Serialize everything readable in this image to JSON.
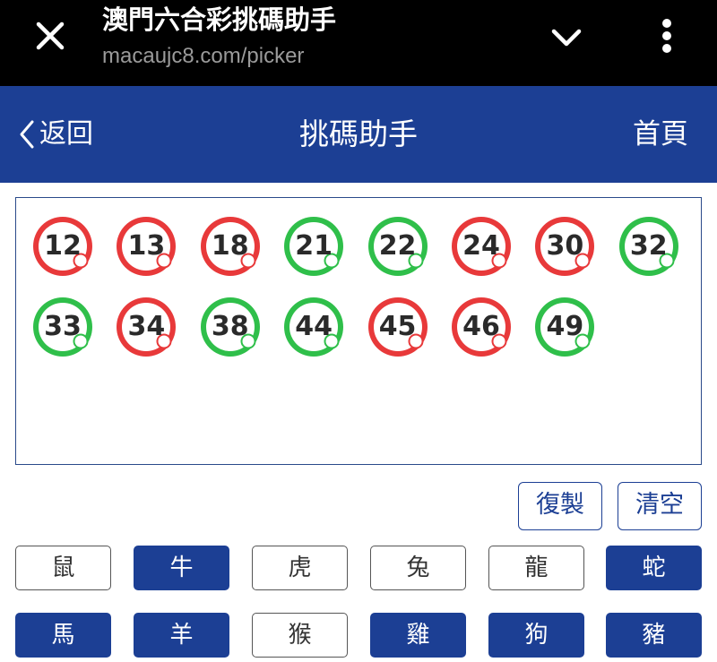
{
  "browser": {
    "title": "澳門六合彩挑碼助手",
    "url": "macaujc8.com/picker"
  },
  "header": {
    "back_label": "返回",
    "title": "挑碼助手",
    "home_label": "首頁",
    "color": "#1c3f94"
  },
  "colors": {
    "red": "#e8393a",
    "green": "#2fbf4a"
  },
  "numbers": [
    {
      "value": "12",
      "color": "red"
    },
    {
      "value": "13",
      "color": "red"
    },
    {
      "value": "18",
      "color": "red"
    },
    {
      "value": "21",
      "color": "green"
    },
    {
      "value": "22",
      "color": "green"
    },
    {
      "value": "24",
      "color": "red"
    },
    {
      "value": "30",
      "color": "red"
    },
    {
      "value": "32",
      "color": "green"
    },
    {
      "value": "33",
      "color": "green"
    },
    {
      "value": "34",
      "color": "red"
    },
    {
      "value": "38",
      "color": "green"
    },
    {
      "value": "44",
      "color": "green"
    },
    {
      "value": "45",
      "color": "red"
    },
    {
      "value": "46",
      "color": "red"
    },
    {
      "value": "49",
      "color": "green"
    }
  ],
  "actions": {
    "copy_label": "復製",
    "clear_label": "清空"
  },
  "zodiacs": [
    {
      "label": "鼠",
      "selected": false
    },
    {
      "label": "牛",
      "selected": true
    },
    {
      "label": "虎",
      "selected": false
    },
    {
      "label": "兔",
      "selected": false
    },
    {
      "label": "龍",
      "selected": false
    },
    {
      "label": "蛇",
      "selected": true
    },
    {
      "label": "馬",
      "selected": true
    },
    {
      "label": "羊",
      "selected": true
    },
    {
      "label": "猴",
      "selected": false
    },
    {
      "label": "雞",
      "selected": true
    },
    {
      "label": "狗",
      "selected": true
    },
    {
      "label": "豬",
      "selected": true
    }
  ]
}
